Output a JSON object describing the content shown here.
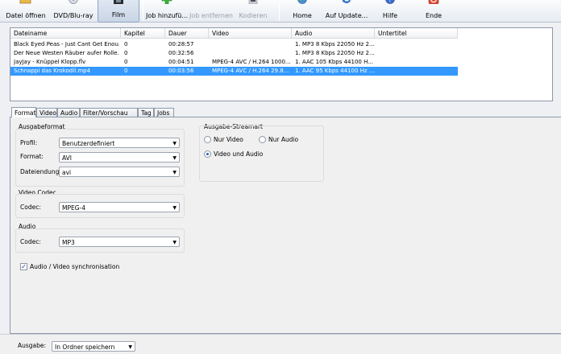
{
  "toolbar": {
    "items": [
      {
        "label": "Datei öffnen",
        "icon": "folder-open-icon",
        "disabled": false,
        "active": false
      },
      {
        "label": "DVD/Blu-ray",
        "icon": "disc-icon",
        "disabled": false,
        "active": false
      },
      {
        "label": "Film",
        "icon": "film-icon",
        "disabled": false,
        "active": true
      },
      {
        "label": "Job hinzufü...",
        "icon": "add-icon",
        "disabled": false,
        "active": false
      },
      {
        "label": "Job entfernen",
        "icon": "remove-icon",
        "disabled": true,
        "active": false
      },
      {
        "label": "Kodieren",
        "icon": "encode-icon",
        "disabled": true,
        "active": false
      },
      {
        "label": "Home",
        "icon": "globe-icon",
        "disabled": false,
        "active": false
      },
      {
        "label": "Auf Update...",
        "icon": "update-icon",
        "disabled": false,
        "active": false
      },
      {
        "label": "Hilfe",
        "icon": "help-icon",
        "disabled": false,
        "active": false
      },
      {
        "label": "Ende",
        "icon": "power-icon",
        "disabled": false,
        "active": false
      }
    ]
  },
  "filelist": {
    "columns": [
      "Dateiname",
      "Kapitel",
      "Dauer",
      "Video",
      "Audio",
      "Untertitel"
    ],
    "rows": [
      {
        "name": "Black Eyed Peas - Just Cant Get Enou...",
        "chapters": "0",
        "duration": "00:28:57",
        "video": "",
        "audio": "1. MP3 8 Kbps 22050 Hz 2...",
        "subs": "",
        "selected": false
      },
      {
        "name": "Der Neue Westen Räuber aufer Rolle...",
        "chapters": "0",
        "duration": "00:32:56",
        "video": "",
        "audio": "1. MP3 8 Kbps 22050 Hz 2...",
        "subs": "",
        "selected": false
      },
      {
        "name": "JayJay - Knüppel Klopp.flv",
        "chapters": "0",
        "duration": "00:04:51",
        "video": "MPEG-4 AVC / H.264 1000...",
        "audio": "1. AAC 105 Kbps 44100 H...",
        "subs": "",
        "selected": false
      },
      {
        "name": "Schnappi das Krokodil.mp4",
        "chapters": "0",
        "duration": "00:03:56",
        "video": "MPEG-4 AVC / H.264 29.8...",
        "audio": "1. AAC 95 Kbps 44100 Hz ...",
        "subs": "",
        "selected": true
      }
    ]
  },
  "tabs": [
    "Format",
    "Video",
    "Audio",
    "Filter/Vorschau",
    "Tag",
    "Jobs"
  ],
  "format": {
    "ausgabeformat_title": "Ausgabeformat",
    "profil_label": "Profil:",
    "profil_value": "Benutzerdefiniert",
    "format_label": "Format:",
    "format_value": "AVI",
    "endung_label": "Dateiendung:",
    "endung_value": "avi",
    "video_codec_title": "Video Codec",
    "vcodec_label": "Codec:",
    "vcodec_value": "MPEG-4",
    "audio_title": "Audio",
    "acodec_label": "Codec:",
    "acodec_value": "MP3",
    "sync_label": "Audio / Video synchronisation",
    "streamart_title": "Ausgabe-Streamart",
    "radio_video": "Nur Video",
    "radio_audio": "Nur Audio",
    "radio_both": "Video und Audio"
  },
  "bottom": {
    "ausgabe_label": "Ausgabe:",
    "ausgabe_value": "In Ordner speichern"
  }
}
